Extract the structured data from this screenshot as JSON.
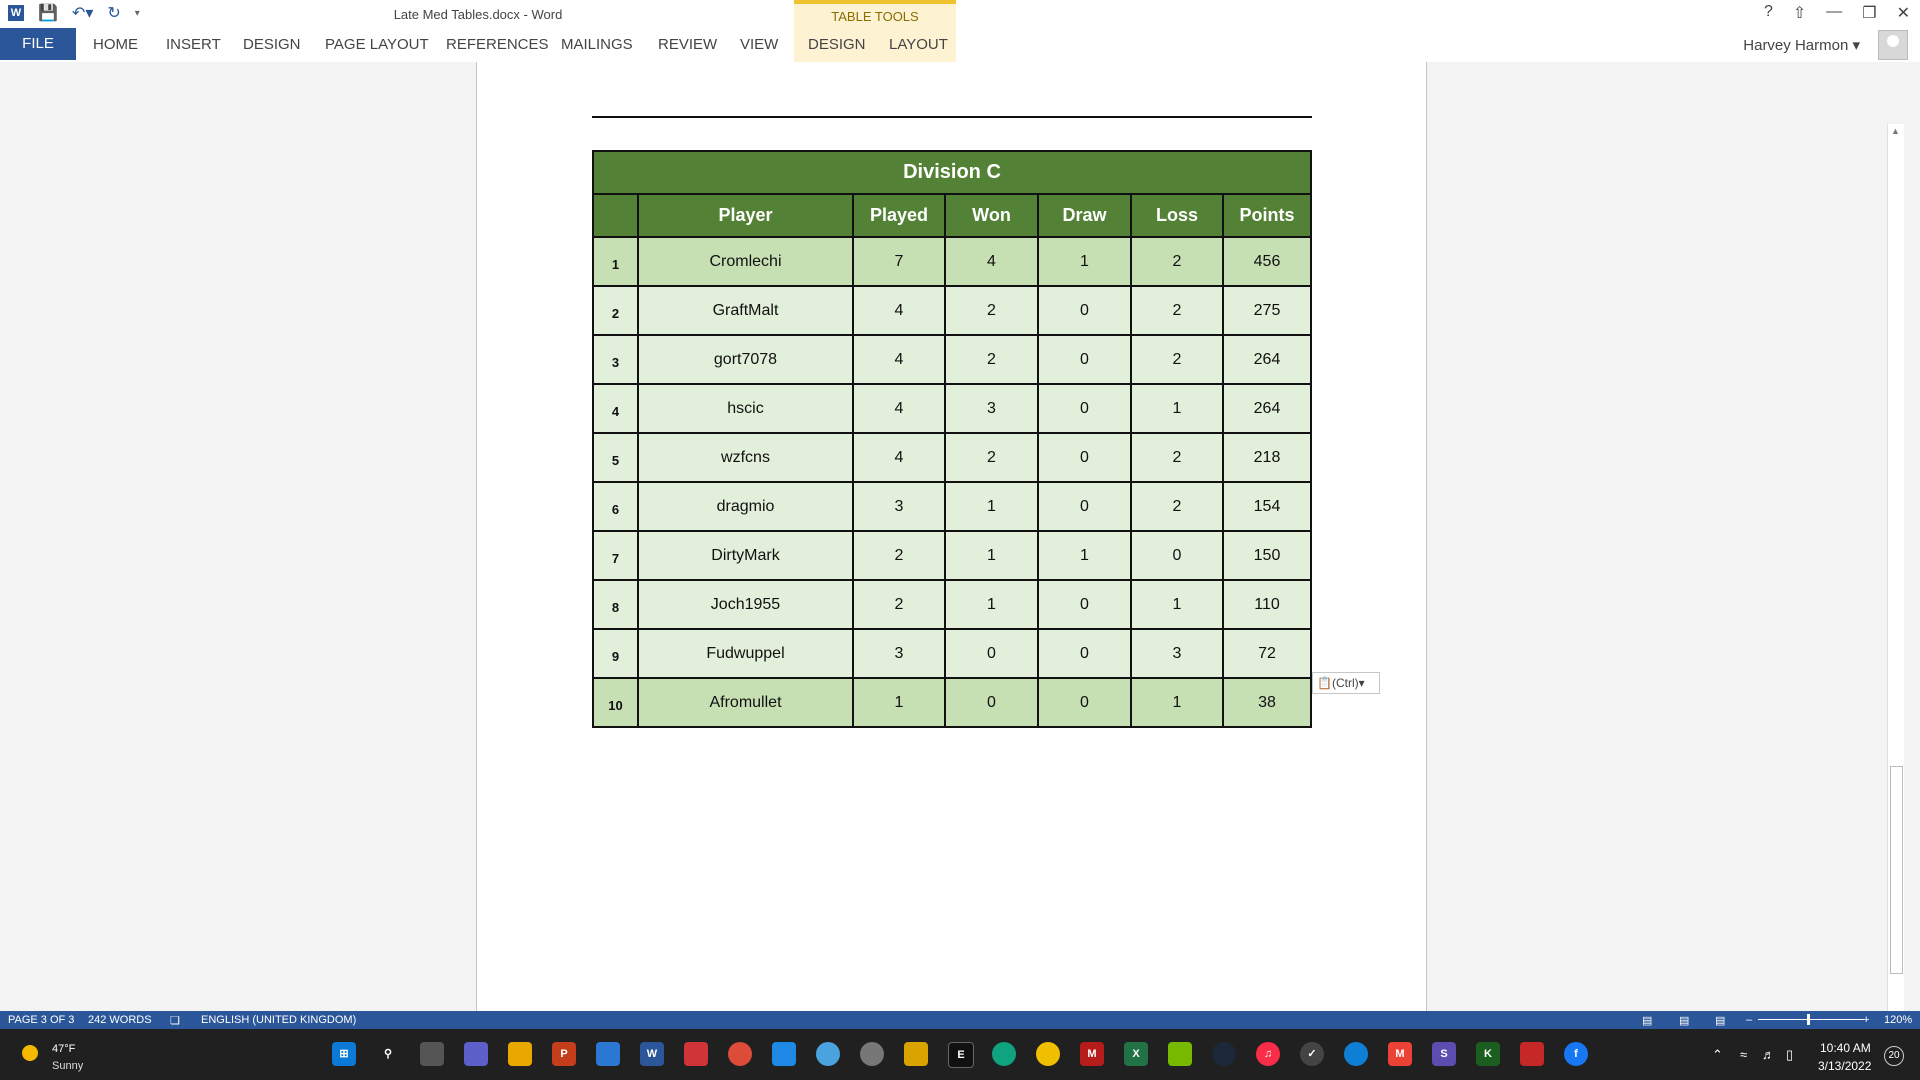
{
  "window": {
    "title": "Late Med Tables.docx - Word",
    "context_group": "TABLE TOOLS",
    "user": "Harvey Harmon"
  },
  "quick_access": [
    "word-app-icon",
    "save-icon",
    "undo-icon",
    "redo-icon",
    "customize-icon"
  ],
  "ribbon": {
    "tabs": [
      "FILE",
      "HOME",
      "INSERT",
      "DESIGN",
      "PAGE LAYOUT",
      "REFERENCES",
      "MAILINGS",
      "REVIEW",
      "VIEW"
    ],
    "context_tabs": [
      "DESIGN",
      "LAYOUT"
    ]
  },
  "table": {
    "title": "Division C",
    "headers": [
      "",
      "Player",
      "Played",
      "Won",
      "Draw",
      "Loss",
      "Points"
    ],
    "rows": [
      {
        "rank": "1",
        "player": "Cromlechi",
        "played": "7",
        "won": "4",
        "draw": "1",
        "loss": "2",
        "points": "456"
      },
      {
        "rank": "2",
        "player": "GraftMalt",
        "played": "4",
        "won": "2",
        "draw": "0",
        "loss": "2",
        "points": "275"
      },
      {
        "rank": "3",
        "player": "gort7078",
        "played": "4",
        "won": "2",
        "draw": "0",
        "loss": "2",
        "points": "264"
      },
      {
        "rank": "4",
        "player": "hscic",
        "played": "4",
        "won": "3",
        "draw": "0",
        "loss": "1",
        "points": "264"
      },
      {
        "rank": "5",
        "player": "wzfcns",
        "played": "4",
        "won": "2",
        "draw": "0",
        "loss": "2",
        "points": "218"
      },
      {
        "rank": "6",
        "player": "dragmio",
        "played": "3",
        "won": "1",
        "draw": "0",
        "loss": "2",
        "points": "154"
      },
      {
        "rank": "7",
        "player": "DirtyMark",
        "played": "2",
        "won": "1",
        "draw": "1",
        "loss": "0",
        "points": "150"
      },
      {
        "rank": "8",
        "player": "Joch1955",
        "played": "2",
        "won": "1",
        "draw": "0",
        "loss": "1",
        "points": "110"
      },
      {
        "rank": "9",
        "player": "Fudwuppel",
        "played": "3",
        "won": "0",
        "draw": "0",
        "loss": "3",
        "points": "72"
      },
      {
        "rank": "10",
        "player": "Afromullet",
        "played": "1",
        "won": "0",
        "draw": "0",
        "loss": "1",
        "points": "38"
      }
    ]
  },
  "paste_options": "(Ctrl)",
  "status": {
    "page": "PAGE 3 OF 3",
    "words": "242 WORDS",
    "language": "ENGLISH (UNITED KINGDOM)",
    "zoom": "120%"
  },
  "taskbar": {
    "temperature": "47°F",
    "weather": "Sunny",
    "time": "10:40 AM",
    "date": "3/13/2022",
    "notifications": "20"
  },
  "colors": {
    "word_blue": "#2b579a",
    "table_header_green": "#538135",
    "row_dark": "#c6e0b4",
    "row_light": "#e2efda",
    "context_tab": "#fdf3d3"
  }
}
